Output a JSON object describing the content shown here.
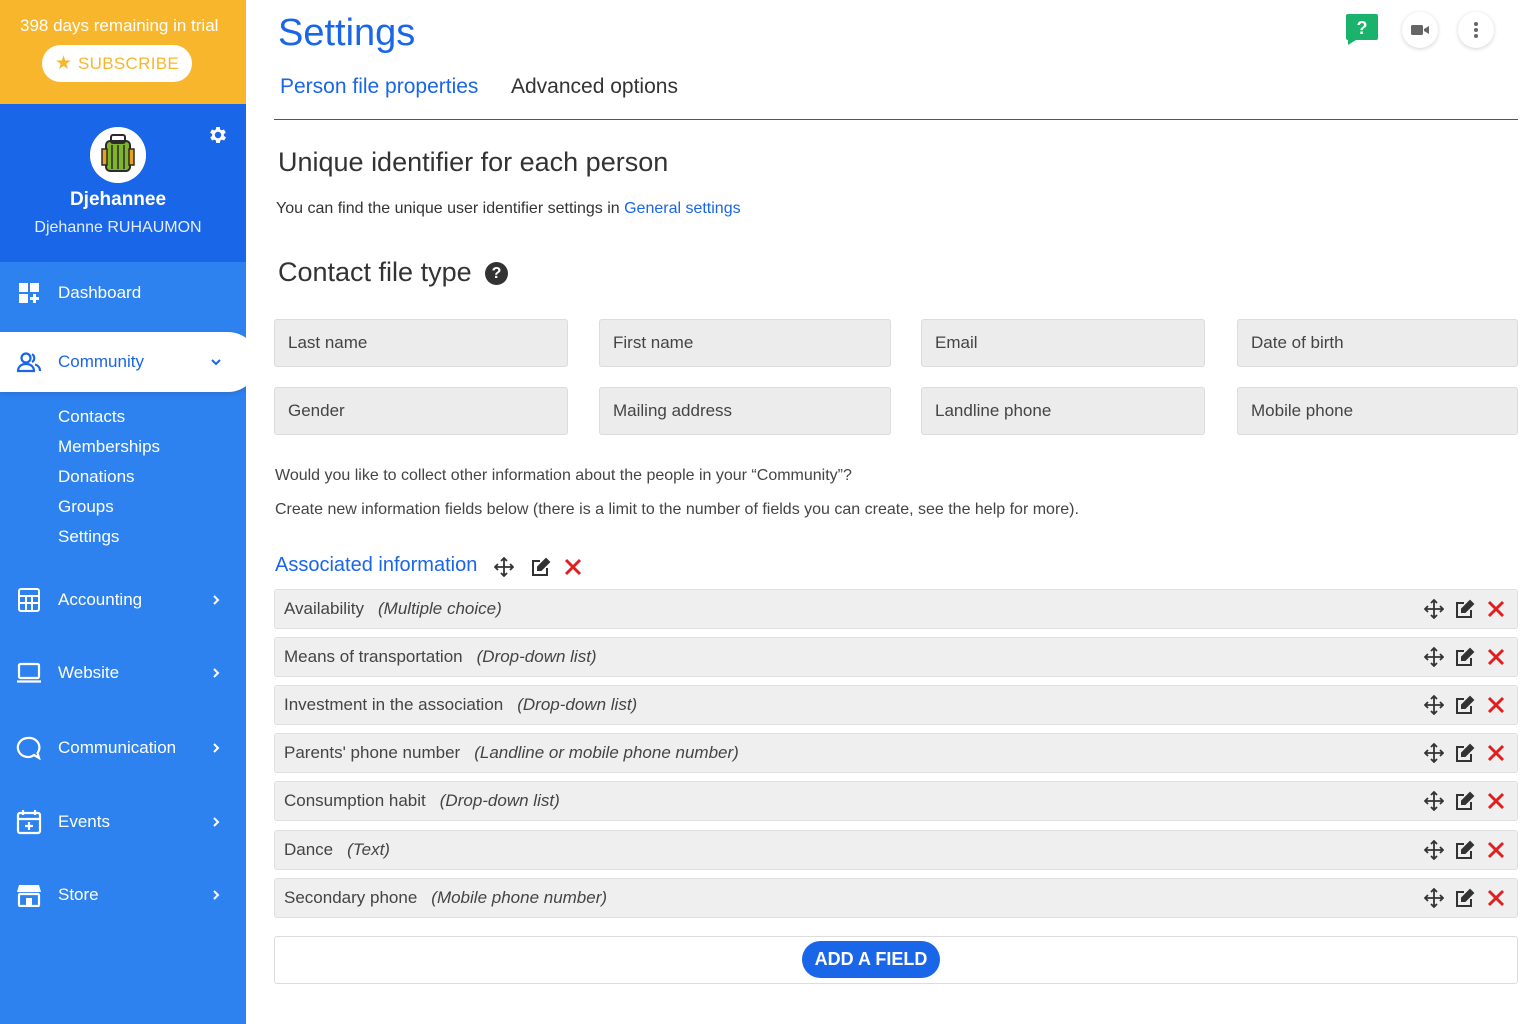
{
  "trial": {
    "text": "398 days remaining in trial",
    "subscribe_label": "SUBSCRIBE"
  },
  "profile": {
    "name": "Djehannee",
    "full_name": "Djehanne RUHAUMON"
  },
  "nav": {
    "dashboard": "Dashboard",
    "community": "Community",
    "community_sub": [
      "Contacts",
      "Memberships",
      "Donations",
      "Groups",
      "Settings"
    ],
    "accounting": "Accounting",
    "website": "Website",
    "communication": "Communication",
    "events": "Events",
    "store": "Store"
  },
  "page": {
    "title": "Settings"
  },
  "tabs": [
    "Person file properties",
    "Advanced options"
  ],
  "unique_id": {
    "title": "Unique identifier for each person",
    "desc_prefix": "You can find the unique user identifier settings in ",
    "desc_link": "General settings"
  },
  "contact_file": {
    "title": "Contact file type",
    "help": "?",
    "fields": [
      "Last name",
      "First name",
      "Email",
      "Date of birth",
      "Gender",
      "Mailing address",
      "Landline phone",
      "Mobile phone"
    ]
  },
  "info_text": {
    "line1": "Would you like to collect other information about the people in your “Community”?",
    "line2": "Create new information fields below (there is a limit to the number of fields you can create, see the help for more)."
  },
  "associated": {
    "title": "Associated information",
    "rows": [
      {
        "name": "Availability",
        "type": "(Multiple choice)"
      },
      {
        "name": "Means of transportation",
        "type": "(Drop-down list)"
      },
      {
        "name": "Investment in the association",
        "type": "(Drop-down list)"
      },
      {
        "name": "Parents' phone number",
        "type": "(Landline or mobile phone number)"
      },
      {
        "name": "Consumption habit",
        "type": "(Drop-down list)"
      },
      {
        "name": "Dance",
        "type": "(Text)"
      },
      {
        "name": "Secondary phone",
        "type": "(Mobile phone number)"
      }
    ]
  },
  "add_field_label": "ADD A FIELD",
  "colors": {
    "primary": "#1a66e8",
    "sidebar": "#2e82f0",
    "trial": "#f8b62c",
    "help_green": "#1bb36b",
    "delete_red": "#e02020"
  },
  "icons": [
    "star-icon",
    "gear-icon",
    "dashboard-icon",
    "community-icon",
    "accounting-icon",
    "website-icon",
    "communication-icon",
    "events-icon",
    "store-icon",
    "help-icon",
    "video-icon",
    "more-icon",
    "move-icon",
    "edit-icon",
    "delete-icon",
    "chevron-down-icon",
    "chevron-right-icon"
  ]
}
